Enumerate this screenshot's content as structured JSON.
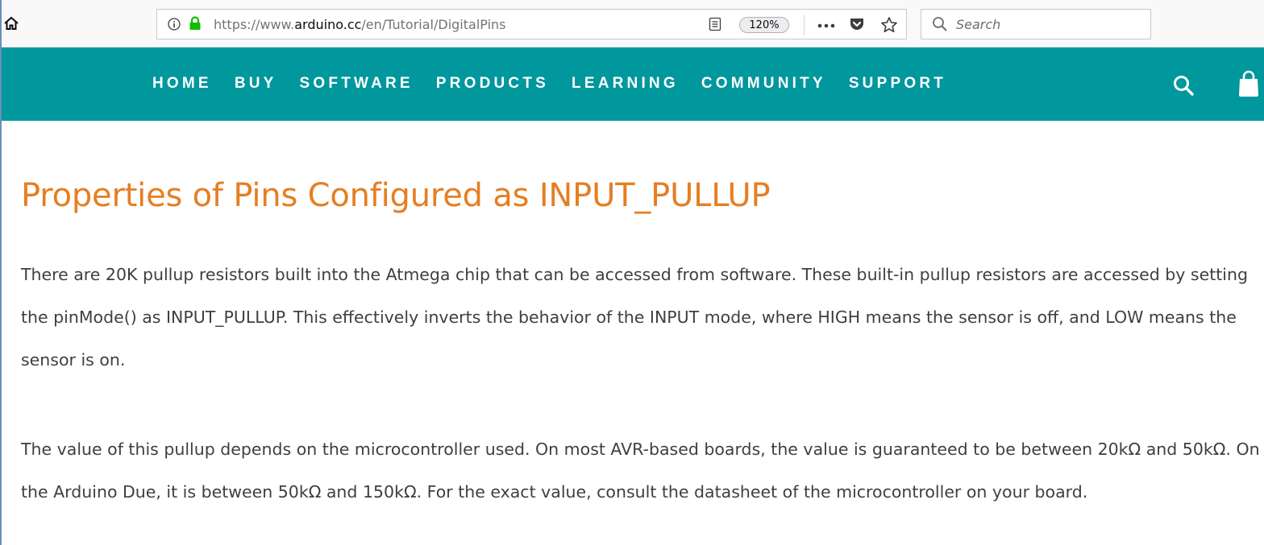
{
  "browser": {
    "url_prefix": "https://www.",
    "url_domain": "arduino.cc",
    "url_path": "/en/Tutorial/DigitalPins",
    "zoom": "120%",
    "search_placeholder": "Search"
  },
  "nav": {
    "items": [
      "HOME",
      "BUY",
      "SOFTWARE",
      "PRODUCTS",
      "LEARNING",
      "COMMUNITY",
      "SUPPORT"
    ]
  },
  "article": {
    "title": "Properties of Pins Configured as INPUT_PULLUP",
    "paragraphs": [
      "There are 20K pullup resistors built into the Atmega chip that can be accessed from software. These built-in pullup resistors are accessed by setting the pinMode() as INPUT_PULLUP. This effectively inverts the behavior of the INPUT mode, where HIGH means the sensor is off, and LOW means the sensor is on.",
      "The value of this pullup depends on the microcontroller used. On most AVR-based boards, the value is guaranteed to be between 20kΩ and 50kΩ. On the Arduino Due, it is between 50kΩ and 150kΩ. For the exact value, consult the datasheet of the microcontroller on your board."
    ]
  },
  "colors": {
    "nav_background": "#00979d",
    "title": "#e67e22",
    "body_text": "#3f3f3f",
    "lock_green": "#12bc00"
  },
  "icons": [
    "home-icon",
    "info-icon",
    "lock-icon",
    "reader-view-icon",
    "more-actions-icon",
    "pocket-icon",
    "bookmark-star-icon",
    "search-icon",
    "shopping-bag-icon"
  ]
}
